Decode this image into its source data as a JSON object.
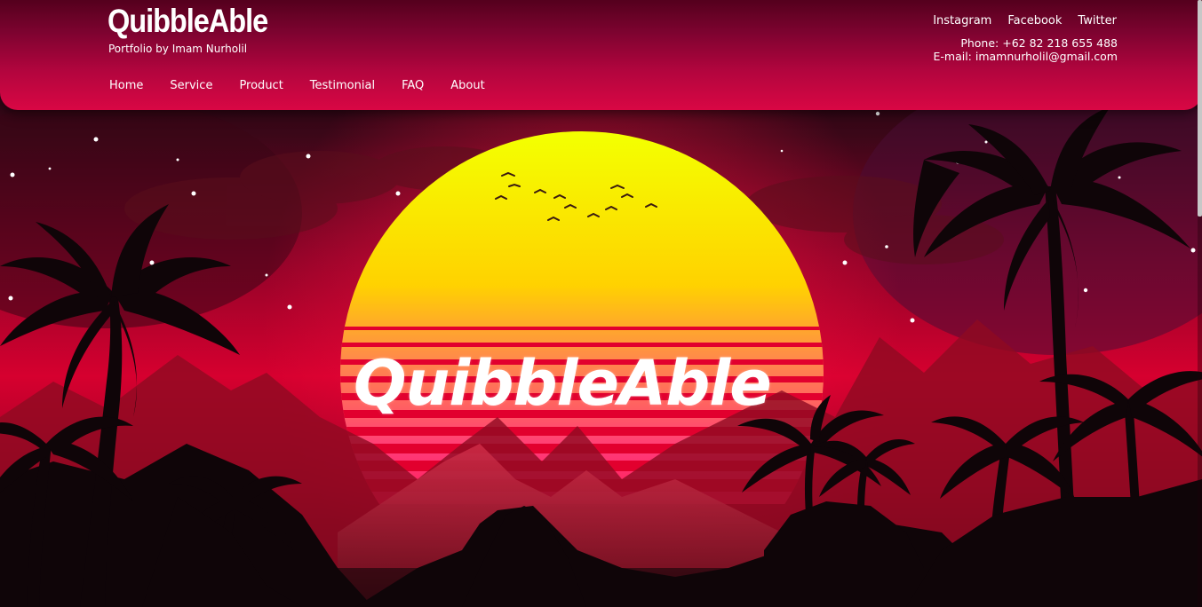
{
  "header": {
    "brand_title": "QuibbleAble",
    "brand_subtitle": "Portfolio by Imam Nurholil",
    "nav": [
      "Home",
      "Service",
      "Product",
      "Testimonial",
      "FAQ",
      "About"
    ],
    "social": [
      "Instagram",
      "Facebook",
      "Twitter"
    ],
    "contact": {
      "phone": "Phone: +62 82 218 655 488",
      "email": "E-mail: imamnurholil@gmail.com"
    }
  },
  "hero": {
    "title": "QuibbleAble",
    "illustration": "synthwave-sunset-palms-illustration"
  },
  "colors": {
    "header_top": "#54001d",
    "header_bottom": "#d90744",
    "sun_top": "#f0ff00",
    "sun_bottom": "#ff2d6f",
    "sky": "#c2002f",
    "silhouette": "#0f0508"
  }
}
